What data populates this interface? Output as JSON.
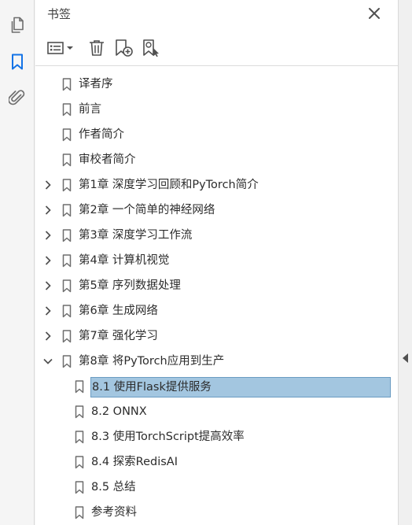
{
  "rail": {
    "items": [
      {
        "name": "pages-icon",
        "active": false
      },
      {
        "name": "bookmark-icon",
        "active": true
      },
      {
        "name": "attachment-icon",
        "active": false
      }
    ],
    "accent": "#1473e6"
  },
  "panel": {
    "title": "书签"
  },
  "toolbar": {
    "icons": [
      "options-menu-icon",
      "delete-bookmark-icon",
      "new-bookmark-icon",
      "new-bookmark-from-selection-icon"
    ]
  },
  "bookmarks": [
    {
      "label": "译者序",
      "level": 0,
      "expandable": false
    },
    {
      "label": "前言",
      "level": 0,
      "expandable": false
    },
    {
      "label": "作者简介",
      "level": 0,
      "expandable": false
    },
    {
      "label": "审校者简介",
      "level": 0,
      "expandable": false
    },
    {
      "label": "第1章 深度学习回顾和PyTorch简介",
      "level": 0,
      "expandable": true,
      "expanded": false
    },
    {
      "label": "第2章 一个简单的神经网络",
      "level": 0,
      "expandable": true,
      "expanded": false
    },
    {
      "label": "第3章 深度学习工作流",
      "level": 0,
      "expandable": true,
      "expanded": false
    },
    {
      "label": "第4章 计算机视觉",
      "level": 0,
      "expandable": true,
      "expanded": false
    },
    {
      "label": "第5章 序列数据处理",
      "level": 0,
      "expandable": true,
      "expanded": false
    },
    {
      "label": "第6章 生成网络",
      "level": 0,
      "expandable": true,
      "expanded": false
    },
    {
      "label": "第7章 强化学习",
      "level": 0,
      "expandable": true,
      "expanded": false
    },
    {
      "label": "第8章 将PyTorch应用到生产",
      "level": 0,
      "expandable": true,
      "expanded": true
    },
    {
      "label": "8.1 使用Flask提供服务",
      "level": 1,
      "expandable": false,
      "selected": true
    },
    {
      "label": "8.2 ONNX",
      "level": 1,
      "expandable": false
    },
    {
      "label": "8.3 使用TorchScript提高效率",
      "level": 1,
      "expandable": false
    },
    {
      "label": "8.4 探索RedisAI",
      "level": 1,
      "expandable": false
    },
    {
      "label": "8.5 总结",
      "level": 1,
      "expandable": false
    },
    {
      "label": "参考资料",
      "level": 1,
      "expandable": false
    }
  ],
  "colors": {
    "selection_bg": "#a3c6e0",
    "selection_border": "#6b9cc2",
    "icon": "#6e6e6e"
  }
}
